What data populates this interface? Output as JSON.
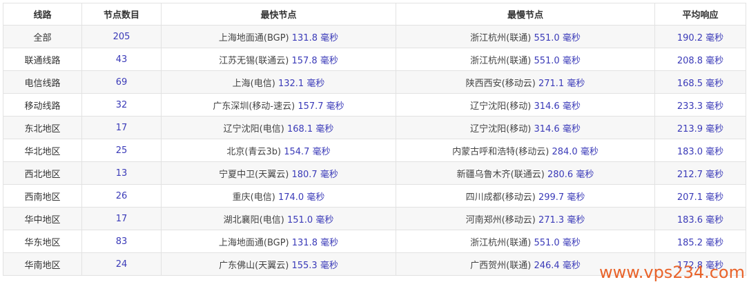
{
  "headers": [
    "线路",
    "节点数目",
    "最快节点",
    "最慢节点",
    "平均响应"
  ],
  "rows": [
    {
      "route": "全部",
      "count": "205",
      "fast_loc": "上海地面通(BGP)",
      "fast_val": "131.8 毫秒",
      "slow_loc": "浙江杭州(联通)",
      "slow_val": "551.0 毫秒",
      "avg": "190.2 毫秒"
    },
    {
      "route": "联通线路",
      "count": "43",
      "fast_loc": "江苏无锡(联通云)",
      "fast_val": "157.8 毫秒",
      "slow_loc": "浙江杭州(联通)",
      "slow_val": "551.0 毫秒",
      "avg": "208.8 毫秒"
    },
    {
      "route": "电信线路",
      "count": "69",
      "fast_loc": "上海(电信)",
      "fast_val": "132.1 毫秒",
      "slow_loc": "陕西西安(移动云)",
      "slow_val": "271.1 毫秒",
      "avg": "168.5 毫秒"
    },
    {
      "route": "移动线路",
      "count": "32",
      "fast_loc": "广东深圳(移动-速云)",
      "fast_val": "157.7 毫秒",
      "slow_loc": "辽宁沈阳(移动)",
      "slow_val": "314.6 毫秒",
      "avg": "233.3 毫秒"
    },
    {
      "route": "东北地区",
      "count": "17",
      "fast_loc": "辽宁沈阳(电信)",
      "fast_val": "168.1 毫秒",
      "slow_loc": "辽宁沈阳(移动)",
      "slow_val": "314.6 毫秒",
      "avg": "213.9 毫秒"
    },
    {
      "route": "华北地区",
      "count": "25",
      "fast_loc": "北京(青云3b)",
      "fast_val": "154.7 毫秒",
      "slow_loc": "内蒙古呼和浩特(移动云)",
      "slow_val": "284.0 毫秒",
      "avg": "183.0 毫秒"
    },
    {
      "route": "西北地区",
      "count": "13",
      "fast_loc": "宁夏中卫(天翼云)",
      "fast_val": "180.7 毫秒",
      "slow_loc": "新疆乌鲁木齐(联通云)",
      "slow_val": "280.6 毫秒",
      "avg": "212.7 毫秒"
    },
    {
      "route": "西南地区",
      "count": "26",
      "fast_loc": "重庆(电信)",
      "fast_val": "174.0 毫秒",
      "slow_loc": "四川成都(移动云)",
      "slow_val": "299.7 毫秒",
      "avg": "207.1 毫秒"
    },
    {
      "route": "华中地区",
      "count": "17",
      "fast_loc": "湖北襄阳(电信)",
      "fast_val": "151.0 毫秒",
      "slow_loc": "河南郑州(移动云)",
      "slow_val": "271.3 毫秒",
      "avg": "183.6 毫秒"
    },
    {
      "route": "华东地区",
      "count": "83",
      "fast_loc": "上海地面通(BGP)",
      "fast_val": "131.8 毫秒",
      "slow_loc": "浙江杭州(联通)",
      "slow_val": "551.0 毫秒",
      "avg": "185.2 毫秒"
    },
    {
      "route": "华南地区",
      "count": "24",
      "fast_loc": "广东佛山(天翼云)",
      "fast_val": "155.3 毫秒",
      "slow_loc": "广西贺州(联通)",
      "slow_val": "246.4 毫秒",
      "avg": "172.8 毫秒"
    }
  ],
  "watermark": "www.vps234.com",
  "colors": {
    "value": "#3a3ab8",
    "border": "#e2e2e2",
    "stripe": "#f7f7f7",
    "watermark": "#e9632a"
  }
}
